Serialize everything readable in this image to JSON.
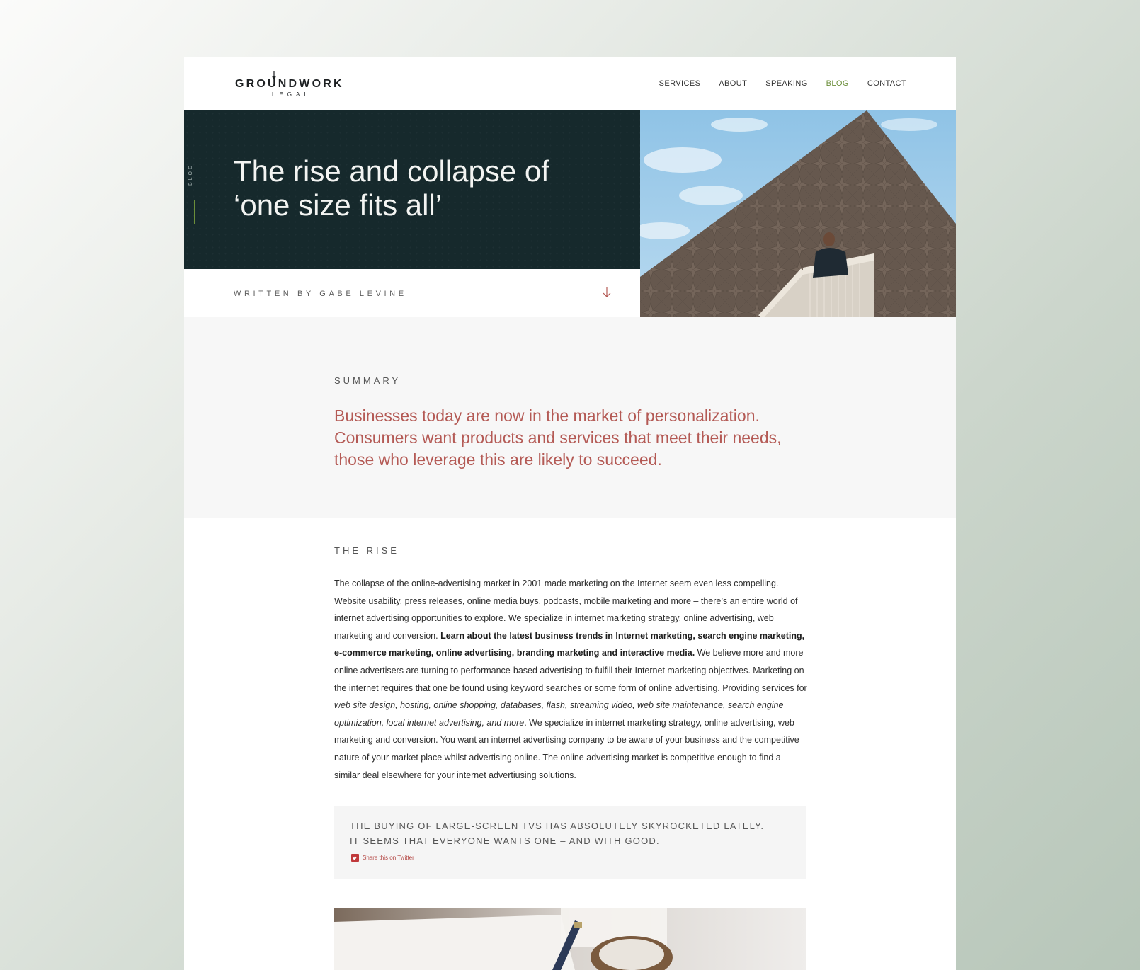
{
  "header": {
    "logo": {
      "name": "GROUNDWORK",
      "sub": "LEGAL"
    },
    "nav": [
      {
        "label": "SERVICES",
        "active": false
      },
      {
        "label": "ABOUT",
        "active": false
      },
      {
        "label": "SPEAKING",
        "active": false
      },
      {
        "label": "BLOG",
        "active": true
      },
      {
        "label": "CONTACT",
        "active": false
      }
    ]
  },
  "hero": {
    "tag": "BLOG",
    "title_line1": "The rise and collapse of",
    "title_line2": "‘one size fits all’",
    "written_by": "WRITTEN BY GABE LEVINE"
  },
  "summary": {
    "label": "SUMMARY",
    "text": "Businesses today are now in the market of personalization. Consumers want products and services that meet their needs, those who leverage this are likely to succeed."
  },
  "section": {
    "label": "THE RISE",
    "p1": "The collapse of the online-advertising market in 2001 made marketing on the Internet seem even less compelling. Website usability, press releases, online media buys, podcasts, mobile marketing and more – there’s an entire world of internet advertising opportunities to explore. We specialize in internet marketing strategy, online advertising, web marketing and conversion. ",
    "bold": "Learn about the latest business trends in Internet marketing, search engine marketing, e-commerce marketing, online advertising, branding marketing and interactive media.",
    "p2": " We believe more and more online advertisers are turning to performance-based advertising to fulfill their Internet marketing objectives. Marketing on the internet requires that one be found using keyword searches or some form of online advertising.   Providing services for ",
    "italic": "web site design, hosting, online shopping, databases, flash, streaming video, web site maintenance, search engine optimization, local internet advertising, and more",
    "p3": ". We specialize in internet marketing strategy, online advertising, web marketing and conversion. You want an internet advertising company to be aware of your business and the competitive nature of your market place whilst advertising online. The ",
    "strike": "online",
    "p4": " advertising market is competitive enough to find a similar deal elsewhere for your internet advertiusing solutions."
  },
  "quote": {
    "text": "THE BUYING OF LARGE-SCREEN TVS HAS ABSOLUTELY SKYROCKETED LATELY. IT SEEMS THAT EVERYONE WANTS ONE – AND WITH GOOD.",
    "share": "Share this on Twitter"
  },
  "icons": {
    "arrow": "arrow-down-icon",
    "twitter": "twitter-icon",
    "logo_mark": "shovel-icon"
  },
  "colors": {
    "hero_bg": "#16292c",
    "accent_red": "#b45a55",
    "active_nav": "#6b8e3a",
    "twitter_red": "#c0393b"
  }
}
